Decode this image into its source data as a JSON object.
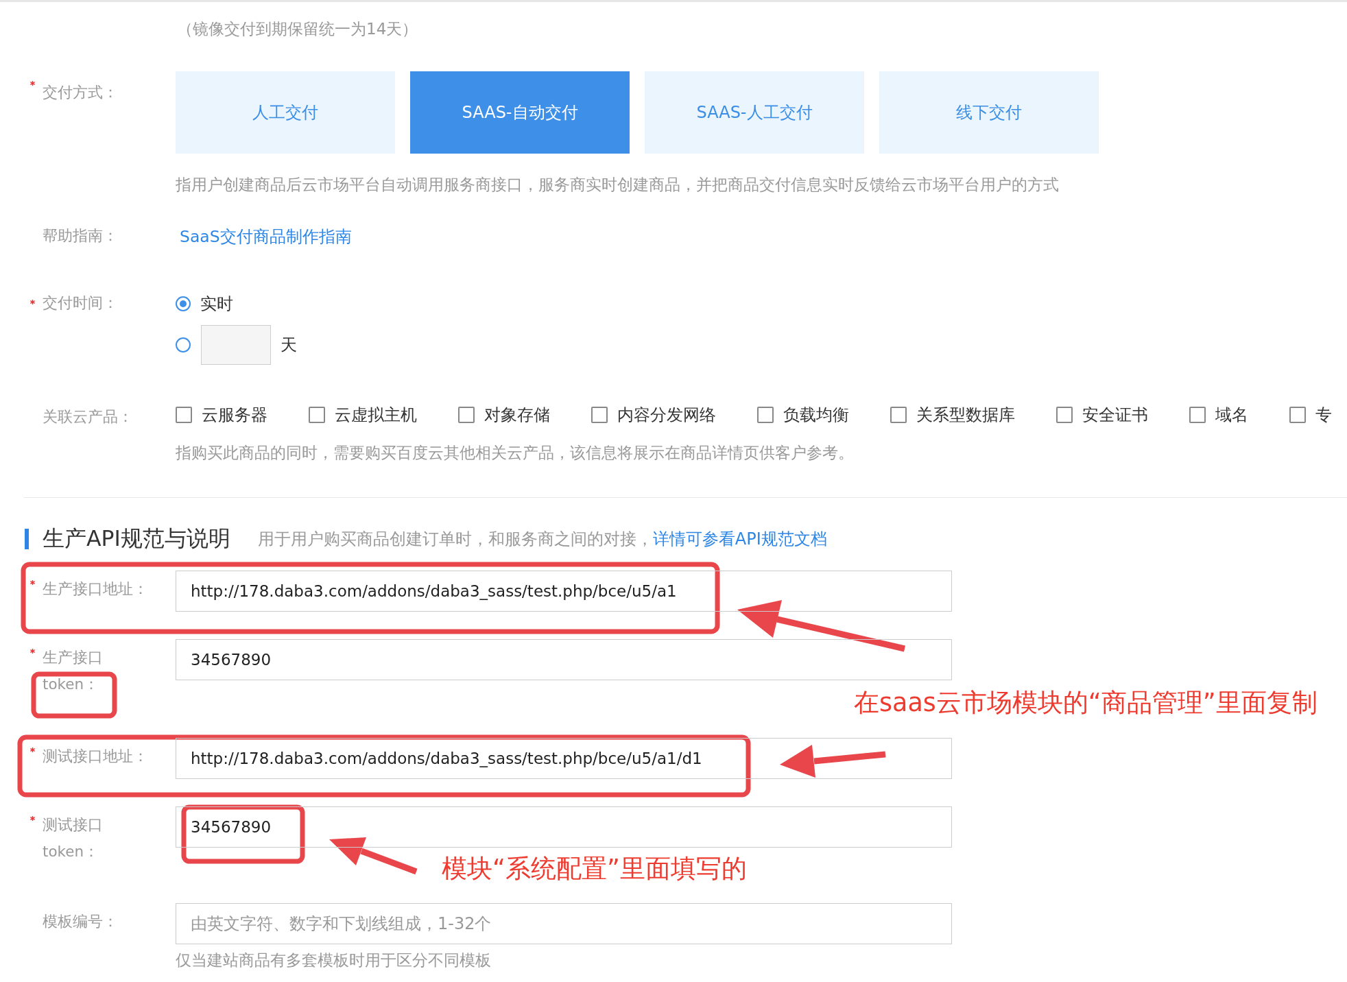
{
  "note": "（镜像交付到期保留统一为14天）",
  "delivery_method": {
    "label": "交付方式：",
    "required": true,
    "options": [
      {
        "label": "人工交付",
        "selected": false
      },
      {
        "label": "SAAS-自动交付",
        "selected": true
      },
      {
        "label": "SAAS-人工交付",
        "selected": false
      },
      {
        "label": "线下交付",
        "selected": false
      }
    ],
    "description": "指用户创建商品后云市场平台自动调用服务商接口，服务商实时创建商品，并把商品交付信息实时反馈给云市场平台用户的方式"
  },
  "help": {
    "label": "帮助指南：",
    "link": "SaaS交付商品制作指南"
  },
  "delivery_time": {
    "label": "交付时间：",
    "required": true,
    "options": [
      {
        "kind": "text",
        "label": "实时",
        "selected": true
      },
      {
        "kind": "days",
        "unit": "天",
        "selected": false
      }
    ]
  },
  "related_products": {
    "label": "关联云产品：",
    "items": [
      {
        "label": "云服务器",
        "checked": false
      },
      {
        "label": "云虚拟主机",
        "checked": false
      },
      {
        "label": "对象存储",
        "checked": false
      },
      {
        "label": "内容分发网络",
        "checked": false
      },
      {
        "label": "负载均衡",
        "checked": false
      },
      {
        "label": "关系型数据库",
        "checked": false
      },
      {
        "label": "安全证书",
        "checked": false
      },
      {
        "label": "域名",
        "checked": false
      },
      {
        "label": "专",
        "checked": false
      }
    ],
    "hint": "指购买此商品的同时，需要购买百度云其他相关云产品，该信息将展示在商品详情页供客户参考。"
  },
  "api_section": {
    "title": "生产API规范与说明",
    "description": "用于用户购买商品创建订单时，和服务商之间的对接，",
    "link": "详情可参看API规范文档",
    "fields": [
      {
        "label": [
          "生产接口地址："
        ],
        "required": true,
        "value": "http://178.daba3.com/addons/daba3_sass/test.php/bce/u5/a1"
      },
      {
        "label": [
          "生产接口",
          "token："
        ],
        "required": true,
        "value": "34567890"
      },
      {
        "label": [
          "测试接口地址："
        ],
        "required": true,
        "value": "http://178.daba3.com/addons/daba3_sass/test.php/bce/u5/a1/d1"
      },
      {
        "label": [
          "测试接口",
          "token："
        ],
        "required": true,
        "value": "34567890"
      },
      {
        "label": [
          "模板编号："
        ],
        "required": false,
        "placeholder": "由英文字符、数字和下划线组成，1-32个",
        "hint": "仅当建站商品有多套模板时用于区分不同模板"
      }
    ]
  },
  "annotations": [
    {
      "text": "在saas云市场模块的“商品管理”里面复制"
    },
    {
      "text": "模块“系统配置”里面填写的"
    }
  ]
}
